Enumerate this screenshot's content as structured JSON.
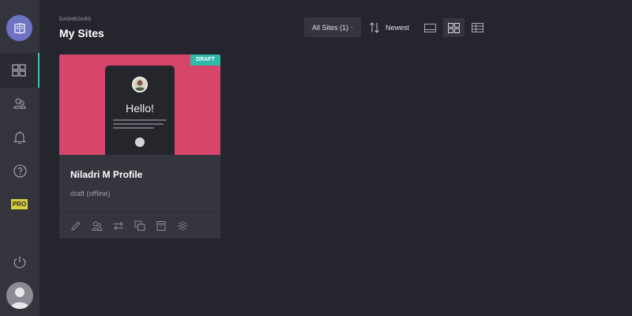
{
  "header": {
    "breadcrumb": "DASHBOARD",
    "title": "My Sites"
  },
  "toolbar": {
    "filter_label": "All Sites (1)",
    "sort_label": "Newest",
    "view_modes": [
      "list",
      "grid",
      "table"
    ],
    "active_view": "grid"
  },
  "sidebar": {
    "items": [
      {
        "icon": "grid-icon",
        "active": true
      },
      {
        "icon": "users-icon",
        "active": false
      },
      {
        "icon": "bell-icon",
        "active": false
      },
      {
        "icon": "help-icon",
        "active": false
      }
    ],
    "pro_label": "PRO",
    "power_icon": "power-icon"
  },
  "sites": [
    {
      "name": "Niladri M Profile",
      "status": "draft (offline)",
      "badge": "DRAFT",
      "preview_greeting": "Hello!"
    }
  ],
  "card_actions": [
    "edit-icon",
    "users-icon",
    "transfer-icon",
    "duplicate-icon",
    "archive-icon",
    "settings-icon"
  ],
  "colors": {
    "background": "#25262d",
    "sidebar": "#33343c",
    "card": "#34353d",
    "accent": "#3cc2b2",
    "thumbnail": "#d7456b",
    "pro": "#d8cf3e",
    "logo": "#6e74c4"
  }
}
